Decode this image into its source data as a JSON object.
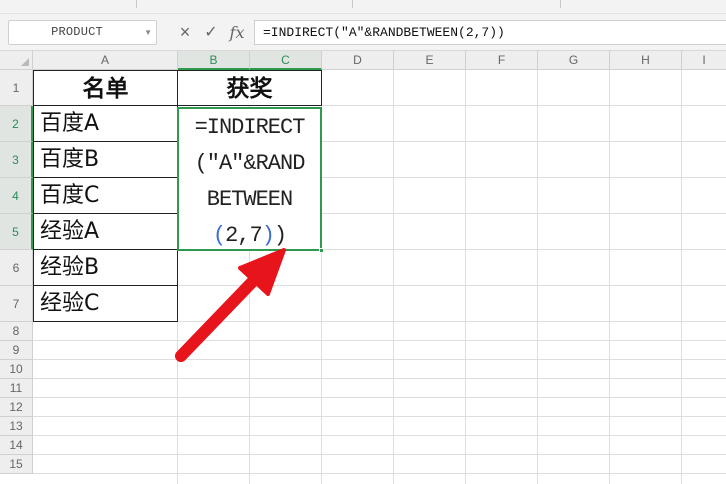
{
  "name_box": {
    "value": "PRODUCT"
  },
  "formula_bar": {
    "cancel_icon": "×",
    "confirm_icon": "✓",
    "fx_label": "fx",
    "formula": "=INDIRECT(\"A\"&RANDBETWEEN(2,7))"
  },
  "columns": [
    "A",
    "B",
    "C",
    "D",
    "E",
    "F",
    "G",
    "H",
    "I"
  ],
  "rows": [
    "1",
    "2",
    "3",
    "4",
    "5",
    "6",
    "7",
    "8",
    "9",
    "10",
    "11",
    "12",
    "13",
    "14",
    "15"
  ],
  "cells": {
    "A1": "名单",
    "A2": "百度A",
    "A3": "百度B",
    "A4": "百度C",
    "A5": "经验A",
    "A6": "经验B",
    "A7": "经验C",
    "B1": "获奖"
  },
  "active_cell_display": {
    "line1": "=INDIRECT",
    "line2": "(\"A\"&RAND",
    "line3": "BETWEEN",
    "line4_open": "(",
    "line4_args": "2,7",
    "line4_close_inner": ")",
    "line4_close_outer": ")"
  },
  "colors": {
    "selection_green": "#2e9a4e",
    "arrow_red": "#e8141c",
    "paren_blue": "#3d6dd6"
  },
  "annotation": {
    "type": "red-arrow",
    "points_to": "active-cell"
  }
}
